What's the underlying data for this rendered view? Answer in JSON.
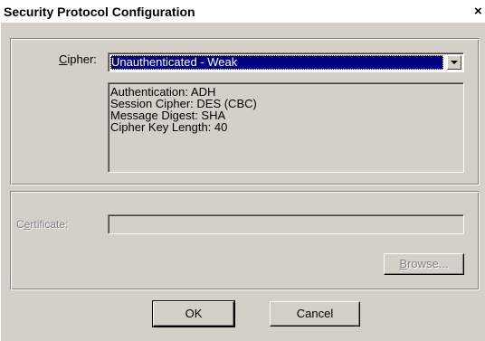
{
  "window": {
    "title": "Security Protocol Configuration",
    "close_glyph": "×"
  },
  "cipher": {
    "label": "Cipher:",
    "label_mnemonic": "C",
    "label_rest": "ipher:",
    "selected": "Unauthenticated - Weak",
    "details": [
      "Authentication: ADH",
      "Session Cipher: DES (CBC)",
      "Message Digest: SHA",
      "Cipher Key Length: 40"
    ]
  },
  "certificate": {
    "label_mnemonic_prefix": "C",
    "label_mnemonic": "e",
    "label_rest": "rtificate:",
    "value": "",
    "enabled": false
  },
  "buttons": {
    "browse_mnemonic": "B",
    "browse_rest": "rowse...",
    "ok": "OK",
    "cancel": "Cancel"
  }
}
